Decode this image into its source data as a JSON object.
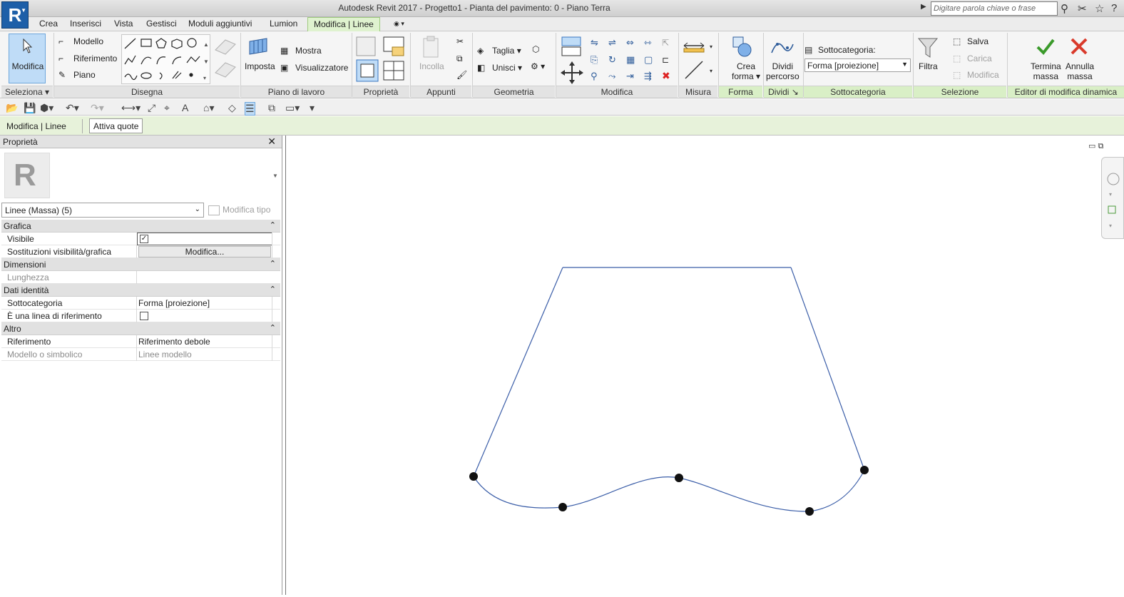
{
  "app": {
    "title": "Autodesk Revit 2017 -     Progetto1 - Pianta del pavimento: 0 - Piano Terra",
    "logo_letter": "R",
    "search_placeholder": "Digitare parola chiave o frase"
  },
  "tabs": [
    "Crea",
    "Inserisci",
    "Vista",
    "Gestisci",
    "Moduli aggiuntivi",
    "Lumion",
    "Modifica | Linee"
  ],
  "ribbon": {
    "seleziona": {
      "button": "Modifica",
      "label": "Seleziona"
    },
    "disegna": {
      "items": [
        "Modello",
        "Riferimento",
        "Piano"
      ],
      "label": "Disegna"
    },
    "piano_di_lavoro": {
      "imposta": "Imposta",
      "mostra": "Mostra",
      "visualizzatore": "Visualizzatore",
      "label": "Piano di lavoro"
    },
    "proprieta": {
      "label": "Proprietà"
    },
    "appunti": {
      "incolla": "Incolla",
      "label": "Appunti"
    },
    "geometria": {
      "taglia": "Taglia",
      "unisci": "Unisci",
      "label": "Geometria"
    },
    "modifica": {
      "label": "Modifica"
    },
    "misura": {
      "label": "Misura"
    },
    "forma": {
      "crea_forma": [
        "Crea",
        "forma"
      ],
      "label": "Forma"
    },
    "dividi": {
      "dividi_percorso": [
        "Dividi",
        "percorso"
      ],
      "label": "Dividi"
    },
    "sottocategoria": {
      "caption": "Sottocategoria:",
      "value": "Forma [proiezione]",
      "label": "Sottocategoria"
    },
    "selezione": {
      "filtra": "Filtra",
      "salva": "Salva",
      "carica": "Carica",
      "modifica": "Modifica",
      "label": "Selezione"
    },
    "editor": {
      "termina": [
        "Termina",
        "massa"
      ],
      "annulla": [
        "Annulla",
        "massa"
      ],
      "label": "Editor di modifica dinamica"
    }
  },
  "options_bar": {
    "context": "Modifica | Linee",
    "attiva_quote": "Attiva quote"
  },
  "properties": {
    "title": "Proprietà",
    "type_selector": "Linee (Massa) (5)",
    "edit_type": "Modifica tipo",
    "groups": [
      {
        "name": "Grafica",
        "rows": [
          {
            "name": "Visibile",
            "value": "",
            "kind": "checkbox",
            "checked": true
          },
          {
            "name": "Sostituzioni visibilità/grafica",
            "value": "Modifica...",
            "kind": "button"
          }
        ]
      },
      {
        "name": "Dimensioni",
        "rows": [
          {
            "name": "Lunghezza",
            "value": "",
            "kind": "text",
            "dim": true
          }
        ]
      },
      {
        "name": "Dati identità",
        "rows": [
          {
            "name": "Sottocategoria",
            "value": "Forma [proiezione]",
            "kind": "text"
          },
          {
            "name": "È una linea di riferimento",
            "value": "",
            "kind": "checkbox",
            "checked": false
          }
        ]
      },
      {
        "name": "Altro",
        "rows": [
          {
            "name": "Riferimento",
            "value": "Riferimento debole",
            "kind": "text"
          },
          {
            "name": "Modello o simbolico",
            "value": "Linee modello",
            "kind": "text",
            "dim": true
          }
        ]
      }
    ]
  },
  "colors": {
    "line": "#3b5ea8",
    "context_tab": "#dff2cf",
    "selection_blue": "#bfdcf7"
  }
}
